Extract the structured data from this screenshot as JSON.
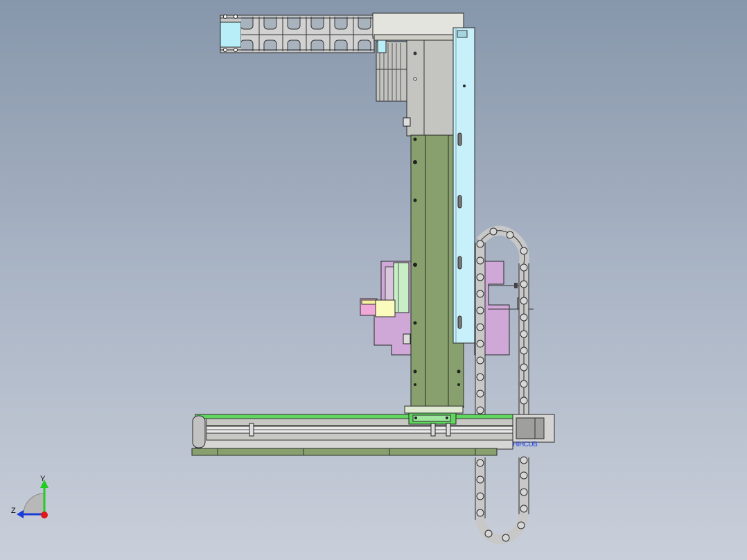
{
  "view": {
    "background_top": "#8797ab",
    "background_bottom": "#c9cfda"
  },
  "triad": {
    "y_label": "Y",
    "z_label": "Z",
    "y_color": "#22cc22",
    "z_color": "#1a3bd6",
    "x_color": "#e01818"
  },
  "part_colors": {
    "column": "#87a06e",
    "slide_plate": "#c8f0fa",
    "carriage": "#cfa8d8",
    "base_rail": "#5fd65f",
    "grey_housing": "#c4c4c0",
    "drag_chain": "#c8c8c8"
  },
  "motor_tag": "HIHCUB"
}
